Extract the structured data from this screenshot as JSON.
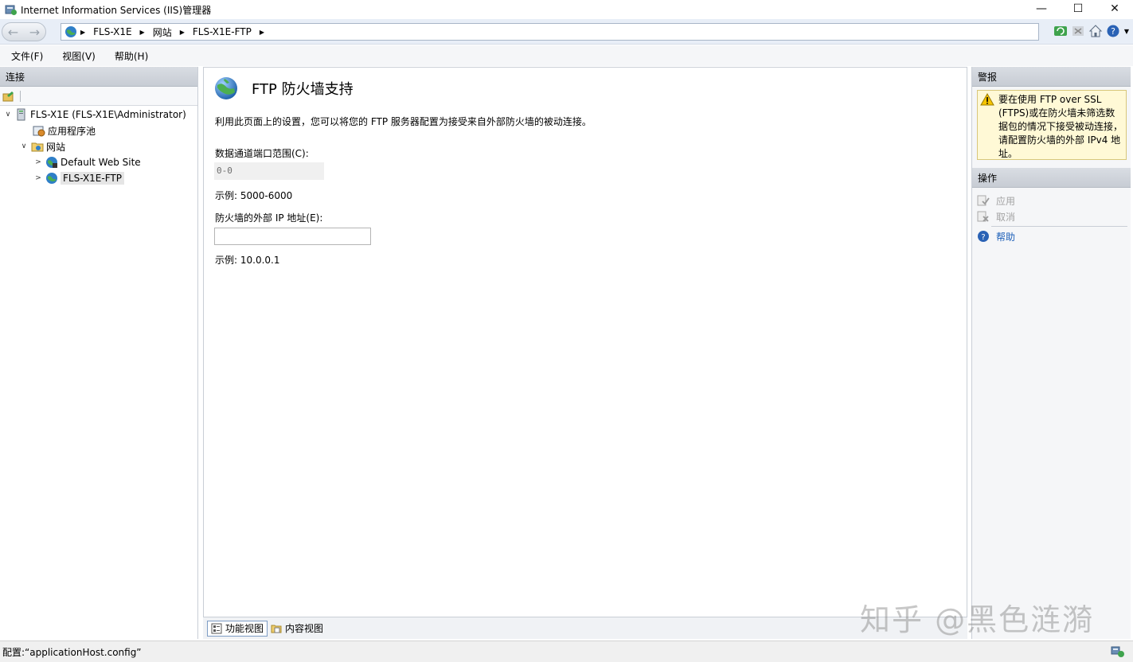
{
  "window": {
    "title": "Internet Information Services (IIS)管理器",
    "minimize": "—",
    "maximize": "☐",
    "close": "✕"
  },
  "address": {
    "back": "←",
    "forward": "→",
    "crumbs": [
      "FLS-X1E",
      "网站",
      "FLS-X1E-FTP"
    ],
    "sep": "▶"
  },
  "menu": {
    "items": [
      "文件(F)",
      "视图(V)",
      "帮助(H)"
    ]
  },
  "connections": {
    "header": "连接",
    "tree": [
      {
        "label": "FLS-X1E (FLS-X1E\\Administrator)",
        "expander": "∨"
      },
      {
        "label": "应用程序池",
        "expander": ""
      },
      {
        "label": "网站",
        "expander": "∨"
      },
      {
        "label": "Default Web Site",
        "expander": ">"
      },
      {
        "label": "FLS-X1E-FTP",
        "expander": ">"
      }
    ]
  },
  "main": {
    "title": "FTP 防火墙支持",
    "description": "利用此页面上的设置，您可以将您的 FTP 服务器配置为接受来自外部防火墙的被动连接。",
    "port_range_label": "数据通道端口范围(C):",
    "port_range_value": "0-0",
    "port_range_example": "示例: 5000-6000",
    "external_ip_label": "防火墙的外部 IP 地址(E):",
    "external_ip_value": "",
    "external_ip_example": "示例: 10.0.0.1"
  },
  "view_tabs": {
    "features": "功能视图",
    "content": "内容视图"
  },
  "alerts": {
    "header": "警报",
    "message": "要在使用 FTP over SSL (FTPS)或在防火墙未筛选数据包的情况下接受被动连接，请配置防火墙的外部 IPv4 地址。"
  },
  "actions": {
    "header": "操作",
    "apply": "应用",
    "cancel": "取消",
    "help": "帮助"
  },
  "status": {
    "text": "配置:“applicationHost.config”"
  },
  "watermark": "知乎 @黑色涟漪"
}
